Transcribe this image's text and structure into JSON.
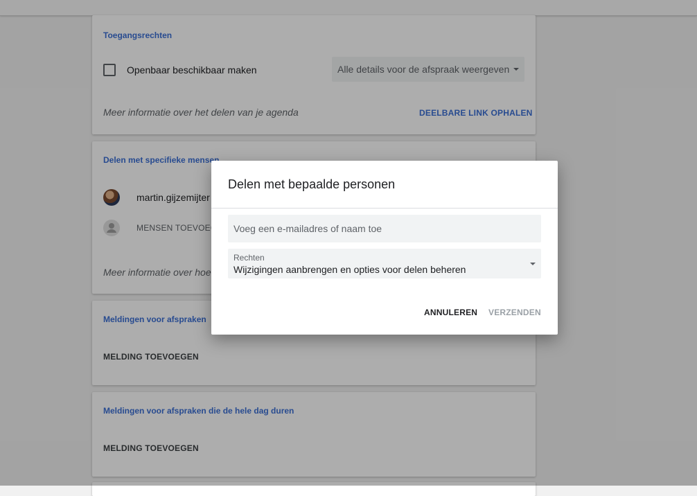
{
  "access": {
    "title": "Toegangsrechten",
    "public_label": "Openbaar beschikbaar maken",
    "visibility_select": "Alle details voor de afspraak weergeven",
    "info": "Meer informatie over het delen van je agenda",
    "link_button": "DEELBARE LINK OPHALEN"
  },
  "share_people": {
    "title": "Delen met specifieke mensen",
    "person": "martin.gijzemijter",
    "add_people": "MENSEN TOEVOEGEN",
    "info": "Meer informatie over hoe"
  },
  "event_notifications": {
    "title": "Meldingen voor afspraken",
    "add": "MELDING TOEVOEGEN"
  },
  "allday_notifications": {
    "title": "Meldingen voor afspraken die de hele dag duren",
    "add": "MELDING TOEVOEGEN"
  },
  "dialog": {
    "title": "Delen met bepaalde personen",
    "input_placeholder": "Voeg een e-mailadres of naam toe",
    "permissions_label": "Rechten",
    "permissions_value": "Wijzigingen aanbrengen en opties voor delen beheren",
    "cancel": "ANNULEREN",
    "send": "VERZENDEN"
  },
  "colors": {
    "accent": "#3b6fd4",
    "disabled": "#9aa0a6"
  }
}
